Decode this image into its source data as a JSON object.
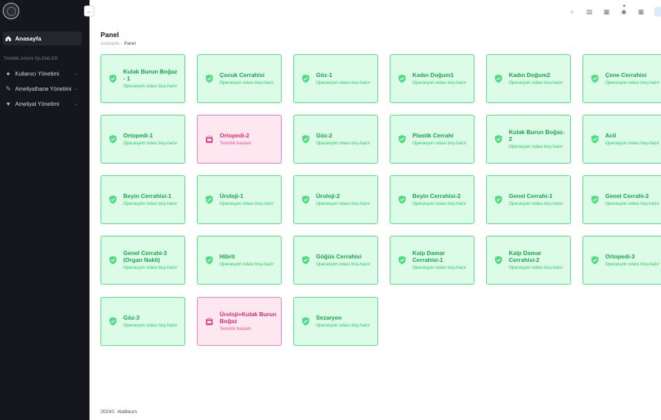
{
  "sidebar": {
    "home_label": "Anasayfa",
    "section_title": "TANIMLANAN İŞLEMLER",
    "items": [
      {
        "label": "Kullanıcı Yönetimi",
        "icon": "user-icon"
      },
      {
        "label": "Ameliyathane Yönetimi",
        "icon": "scalpel-icon"
      },
      {
        "label": "Ameliyat Yönetimi",
        "icon": "heartbeat-icon"
      }
    ]
  },
  "header": {
    "title": "Panel",
    "breadcrumb_home": "Anasayfa",
    "breadcrumb_sep": "–",
    "breadcrumb_current": "Panel"
  },
  "colors": {
    "ready_bg": "#dcfce7",
    "ready_border": "#4ade80",
    "cleaning_bg": "#fde8ef",
    "cleaning_border": "#f472b6",
    "sidebar_bg": "#15171c"
  },
  "rooms": [
    {
      "name": "Kulak Burun Boğaz - 1",
      "status": "Operasyon odası boş-hazır",
      "state": "ready"
    },
    {
      "name": "Çocuk Cerrahisi",
      "status": "Operasyon odası boş-hazır",
      "state": "ready"
    },
    {
      "name": "Göz-1",
      "status": "Operasyon odası boş-hazır",
      "state": "ready"
    },
    {
      "name": "Kadın Doğum1",
      "status": "Operasyon odası boş-hazır",
      "state": "ready"
    },
    {
      "name": "Kadın Doğum2",
      "status": "Operasyon odası boş-hazır",
      "state": "ready"
    },
    {
      "name": "Çene Cerrahisi",
      "status": "Operasyon odası boş-hazır",
      "state": "ready"
    },
    {
      "name": "Ortopedi-1",
      "status": "Operasyon odası boş-hazır",
      "state": "ready"
    },
    {
      "name": "Ortopedi-2",
      "status": "Temizlik başladı",
      "state": "cleaning"
    },
    {
      "name": "Göz-2",
      "status": "Operasyon odası boş-hazır",
      "state": "ready"
    },
    {
      "name": "Plastik Cerrahi",
      "status": "Operasyon odası boş-hazır",
      "state": "ready"
    },
    {
      "name": "Kulak Burun Boğaz-2",
      "status": "Operasyon odası boş-hazır",
      "state": "ready"
    },
    {
      "name": "Acil",
      "status": "Operasyon odası boş-hazır",
      "state": "ready"
    },
    {
      "name": "Beyin Cerrahisi-1",
      "status": "Operasyon odası boş-hazır",
      "state": "ready"
    },
    {
      "name": "Üroloji-1",
      "status": "Operasyon odası boş-hazır",
      "state": "ready"
    },
    {
      "name": "Üroloji-2",
      "status": "Operasyon odası boş-hazır",
      "state": "ready"
    },
    {
      "name": "Beyin Cerrahisi-2",
      "status": "Operasyon odası boş-hazır",
      "state": "ready"
    },
    {
      "name": "Genel Cerrahi-1",
      "status": "Operasyon odası boş-hazır",
      "state": "ready"
    },
    {
      "name": "Genel Cerrahi-2",
      "status": "Operasyon odası boş-hazır",
      "state": "ready"
    },
    {
      "name": "Genel Cerrahi-3 (Organ Nakli)",
      "status": "Operasyon odası boş-hazır",
      "state": "ready"
    },
    {
      "name": "Hibrit",
      "status": "Operasyon odası boş-hazır",
      "state": "ready"
    },
    {
      "name": "Göğüs Cerrahisi",
      "status": "Operasyon odası boş-hazır",
      "state": "ready"
    },
    {
      "name": "Kalp Damar Cerrahisi-1",
      "status": "Operasyon odası boş-hazır",
      "state": "ready"
    },
    {
      "name": "Kalp Damar Cerrahisi-2",
      "status": "Operasyon odası boş-hazır",
      "state": "ready"
    },
    {
      "name": "Ortopedi-3",
      "status": "Operasyon odası boş-hazır",
      "state": "ready"
    },
    {
      "name": "Göz-3",
      "status": "Operasyon odası boş-hazır",
      "state": "ready"
    },
    {
      "name": "Üroloji+Kulak Burun Boğaz",
      "status": "Temizlik başladı",
      "state": "cleaning"
    },
    {
      "name": "Sezaryen",
      "status": "Operasyon odası boş-hazır",
      "state": "ready"
    }
  ],
  "footer": {
    "year": "2024©",
    "brand": "AtaBaum"
  }
}
